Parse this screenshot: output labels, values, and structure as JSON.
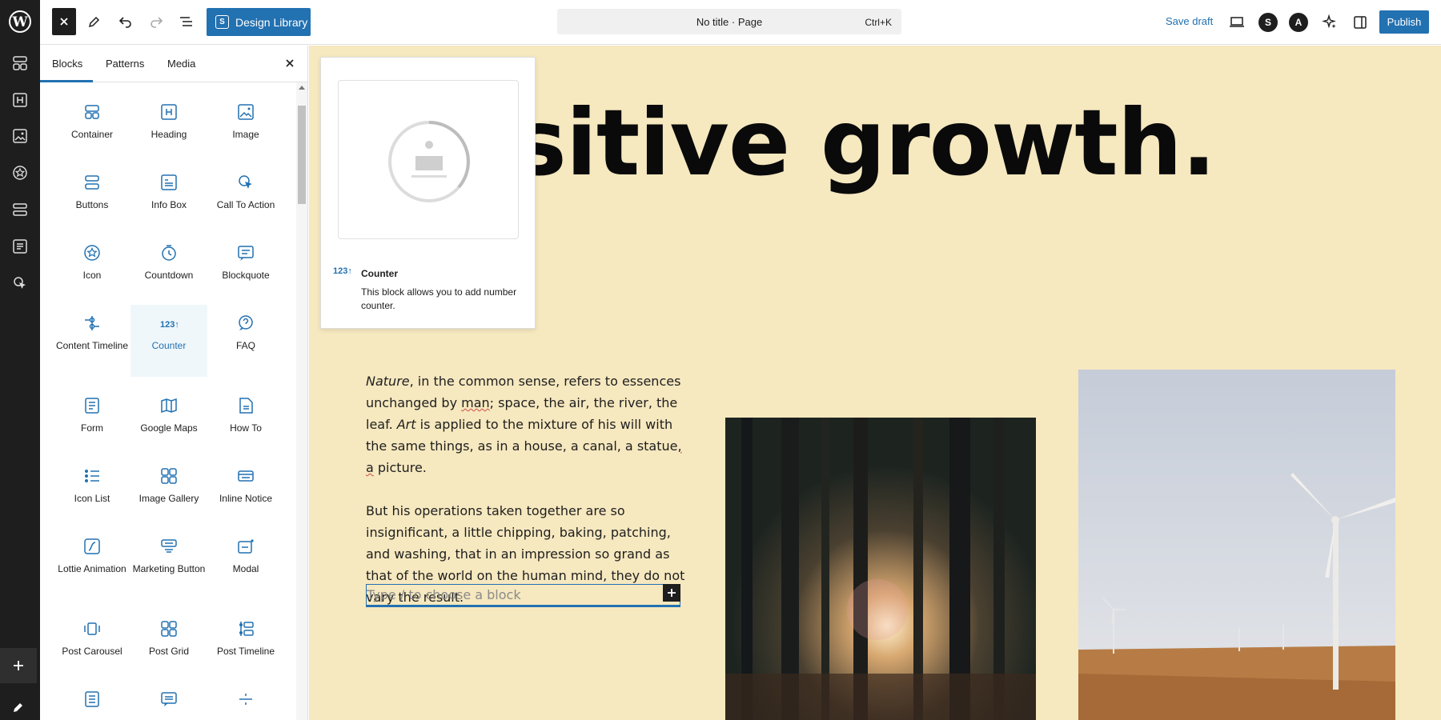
{
  "colors": {
    "accent": "#2271b1",
    "canvas_bg": "#f6e8bf",
    "admin_bar": "#1e1e1e"
  },
  "admin_sidebar": {
    "logo": "wordpress-icon",
    "items": [
      "layout-icon",
      "heading-icon",
      "image-icon",
      "badge-icon",
      "list-icon",
      "document-icon",
      "cursor-click-icon"
    ],
    "bottom": [
      "plus-icon",
      "pencil-icon"
    ]
  },
  "toolbar": {
    "design_library_label": "Design Library",
    "design_library_glyph": "S",
    "command_title": "No title · Page",
    "command_shortcut": "Ctrl+K",
    "save_draft_label": "Save draft",
    "publish_label": "Publish",
    "spectra_glyph": "S",
    "astra_glyph": "A"
  },
  "inserter": {
    "tabs": [
      "Blocks",
      "Patterns",
      "Media"
    ],
    "active_tab": "Blocks",
    "blocks": [
      {
        "label": "Container",
        "icon": "container-icon"
      },
      {
        "label": "Heading",
        "icon": "heading-icon"
      },
      {
        "label": "Image",
        "icon": "image-icon"
      },
      {
        "label": "Buttons",
        "icon": "buttons-icon"
      },
      {
        "label": "Info Box",
        "icon": "info-box-icon"
      },
      {
        "label": "Call To Action",
        "icon": "call-to-action-icon"
      },
      {
        "label": "Icon",
        "icon": "icon-icon"
      },
      {
        "label": "Countdown",
        "icon": "countdown-icon"
      },
      {
        "label": "Blockquote",
        "icon": "blockquote-icon"
      },
      {
        "label": "Content Timeline",
        "icon": "timeline-icon"
      },
      {
        "label": "Counter",
        "icon": "counter-icon",
        "selected": true
      },
      {
        "label": "FAQ",
        "icon": "faq-icon"
      },
      {
        "label": "Form",
        "icon": "form-icon"
      },
      {
        "label": "Google Maps",
        "icon": "map-icon"
      },
      {
        "label": "How To",
        "icon": "how-to-icon"
      },
      {
        "label": "Icon List",
        "icon": "icon-list-icon"
      },
      {
        "label": "Image Gallery",
        "icon": "gallery-icon"
      },
      {
        "label": "Inline Notice",
        "icon": "notice-icon"
      },
      {
        "label": "Lottie Animation",
        "icon": "lottie-icon"
      },
      {
        "label": "Marketing Button",
        "icon": "marketing-button-icon"
      },
      {
        "label": "Modal",
        "icon": "modal-icon"
      },
      {
        "label": "Post Carousel",
        "icon": "carousel-icon"
      },
      {
        "label": "Post Grid",
        "icon": "post-grid-icon"
      },
      {
        "label": "Post Timeline",
        "icon": "post-timeline-icon"
      },
      {
        "label": "",
        "icon": "price-list-icon"
      },
      {
        "label": "",
        "icon": "review-icon"
      },
      {
        "label": "",
        "icon": "separator-icon"
      }
    ]
  },
  "preview": {
    "icon_text": "123↑",
    "title": "Counter",
    "description": "This block allows you to add number counter."
  },
  "canvas": {
    "headline": "sitive growth.",
    "paragraph1_italic1": "Nature",
    "paragraph1_text1": ", in the common sense, refers to essences unchanged by ",
    "paragraph1_sq1": "man",
    "paragraph1_text2": "; space, the air, the river, the leaf. ",
    "paragraph1_italic2": "Art",
    "paragraph1_text3": " is applied to the mixture of his will with the same things, as in a house, a canal, a statue",
    "paragraph1_sq2": ", a",
    "paragraph1_text4": " picture.",
    "paragraph2": "But his operations taken together are so insignificant, a little chipping, baking, patching, and washing, that in an impression so grand as that of the world on the human mind, they do not vary the result.",
    "block_placeholder": "Type / to choose a block"
  }
}
